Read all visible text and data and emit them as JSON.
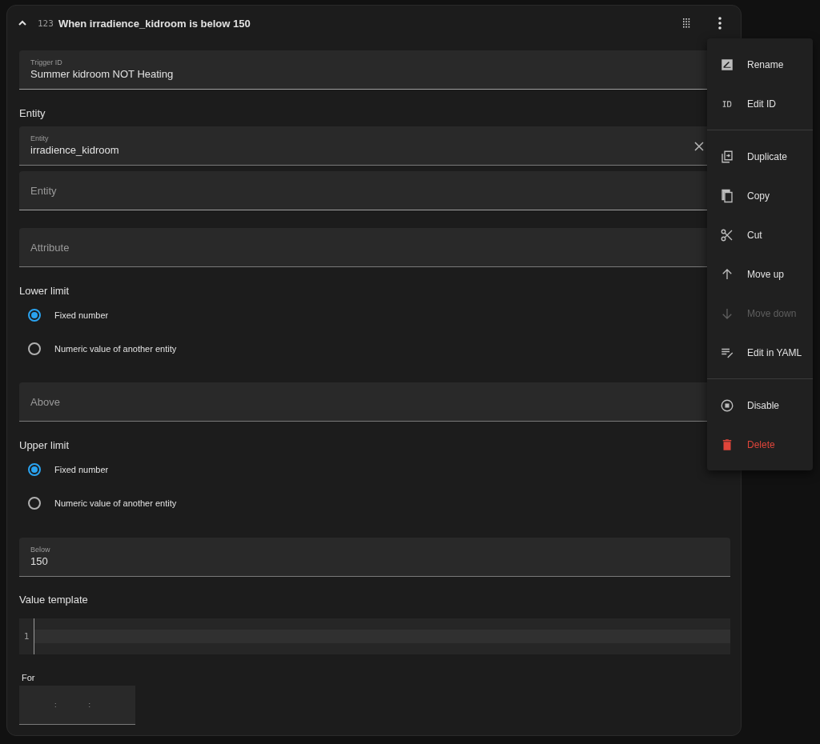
{
  "card": {
    "title": "When irradience_kidroom is below 150",
    "type_badge": "123",
    "expanded": true
  },
  "trigger_id": {
    "label": "Trigger ID",
    "value": "Summer kidroom NOT Heating"
  },
  "entity": {
    "heading": "Entity",
    "fields": [
      {
        "kind": "filled",
        "label": "Entity",
        "value": "irradience_kidroom",
        "clearable": true
      },
      {
        "kind": "empty",
        "placeholder": "Entity",
        "clearable": false
      }
    ]
  },
  "attribute": {
    "placeholder": "Attribute"
  },
  "lower_limit": {
    "heading": "Lower limit",
    "options": [
      {
        "label": "Fixed number",
        "selected": true
      },
      {
        "label": "Numeric value of another entity",
        "selected": false
      }
    ],
    "field": {
      "placeholder": "Above"
    }
  },
  "upper_limit": {
    "heading": "Upper limit",
    "options": [
      {
        "label": "Fixed number",
        "selected": true
      },
      {
        "label": "Numeric value of another entity",
        "selected": false
      }
    ],
    "field": {
      "label": "Below",
      "value": "150"
    }
  },
  "value_template": {
    "heading": "Value template",
    "line_numbers": [
      "1"
    ]
  },
  "duration": {
    "label": "For",
    "separators": [
      ":",
      ":"
    ]
  },
  "menu": [
    {
      "kind": "item",
      "label": "Rename",
      "disabled": false,
      "danger": false
    },
    {
      "kind": "item",
      "label": "Edit ID",
      "disabled": false,
      "danger": false
    },
    {
      "kind": "divider"
    },
    {
      "kind": "item",
      "label": "Duplicate",
      "disabled": false,
      "danger": false
    },
    {
      "kind": "item",
      "label": "Copy",
      "disabled": false,
      "danger": false
    },
    {
      "kind": "item",
      "label": "Cut",
      "disabled": false,
      "danger": false
    },
    {
      "kind": "item",
      "label": "Move up",
      "disabled": false,
      "danger": false
    },
    {
      "kind": "item",
      "label": "Move down",
      "disabled": true,
      "danger": false
    },
    {
      "kind": "item",
      "label": "Edit in YAML",
      "disabled": false,
      "danger": false
    },
    {
      "kind": "divider"
    },
    {
      "kind": "item",
      "label": "Disable",
      "disabled": false,
      "danger": false
    },
    {
      "kind": "item",
      "label": "Delete",
      "disabled": false,
      "danger": true
    }
  ]
}
